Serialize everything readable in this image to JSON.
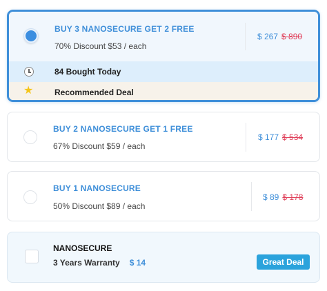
{
  "offers": [
    {
      "title": "BUY 3 NANOSECURE GET 2 FREE",
      "discount": "70% Discount $53 / each",
      "price": "$ 267",
      "old_price": "$ 890",
      "selected": true,
      "bought_today": "84 Bought Today",
      "recommended": "Recommended Deal"
    },
    {
      "title": "BUY 2 NANOSECURE GET 1 FREE",
      "discount": "67% Discount $59 / each",
      "price": "$ 177",
      "old_price": "$ 534",
      "selected": false
    },
    {
      "title": "BUY 1 NANOSECURE",
      "discount": "50% Discount $89 / each",
      "price": "$ 89",
      "old_price": "$ 178",
      "selected": false
    }
  ],
  "warranty": {
    "title": "NANOSECURE",
    "subtitle": "3 Years Warranty",
    "price": "$ 14",
    "badge": "Great Deal",
    "checked": false
  },
  "icons": {
    "bought": "clock-icon",
    "recommended": "star-icon"
  },
  "colors": {
    "accent": "#3f8fd9",
    "old_price": "#e0405a",
    "badge": "#2ba3dc",
    "bought_row": "#ddeefc",
    "recommended_row": "#f7f2ea"
  }
}
